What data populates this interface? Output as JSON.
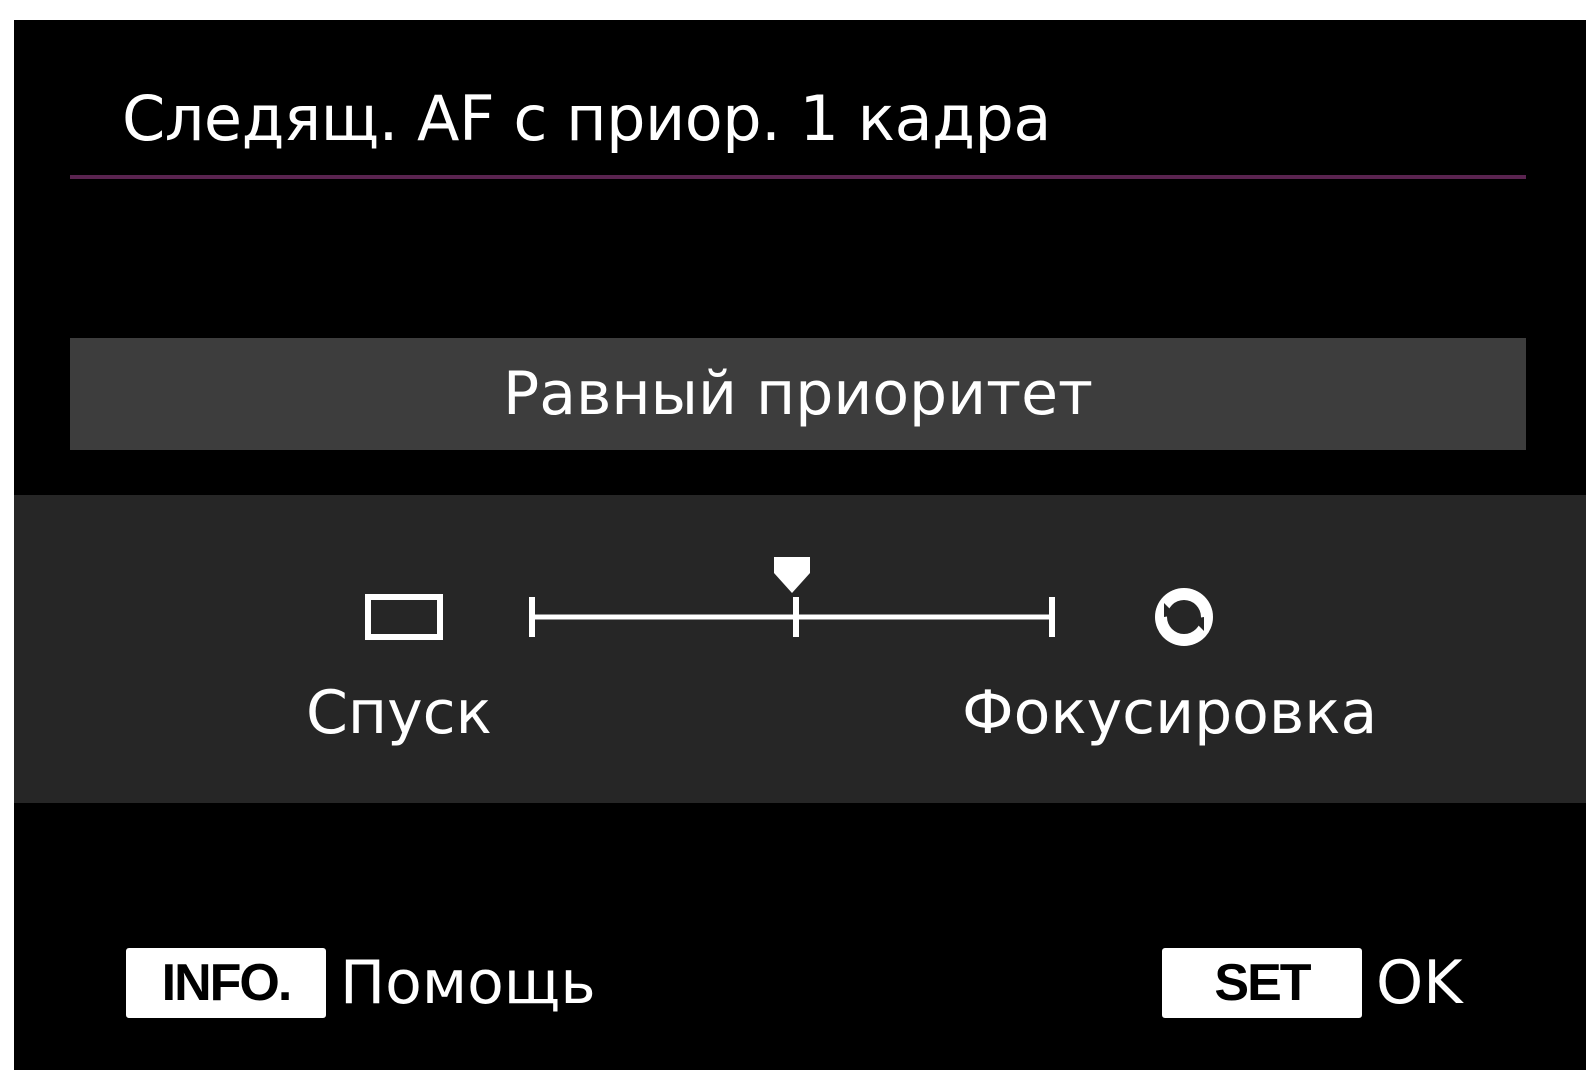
{
  "header": {
    "title": "Следящ. AF с приор. 1 кадра"
  },
  "setting": {
    "current_value": "Равный приоритет",
    "slider": {
      "left_label": "Спуск",
      "right_label": "Фокусировка",
      "left_icon": "single-frame-icon",
      "right_icon": "focus-priority-icon",
      "positions": 3,
      "selected_index": 1
    }
  },
  "footer": {
    "info_key": "INFO.",
    "info_label": "Помощь",
    "set_key": "SET",
    "set_label": "OK"
  },
  "colors": {
    "accent_rule": "#5a2450",
    "value_bar": "#3d3d3d",
    "slider_panel": "#262626"
  }
}
